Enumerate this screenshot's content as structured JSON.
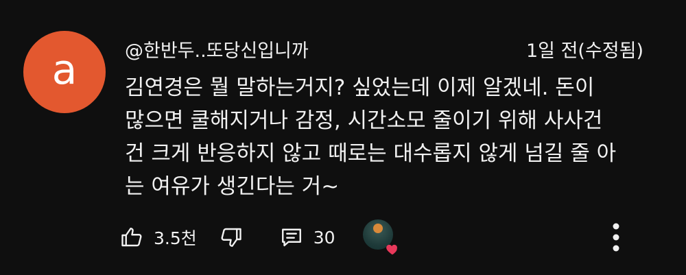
{
  "comment": {
    "avatar_letter": "a",
    "avatar_color": "#e3582f",
    "author_handle": "@한반두..또당신입니까",
    "timestamp": "1일 전(수정됨)",
    "text_lines": [
      "김연경은 뭘 말하는거지? 싶었는데 이제 알겠네. 돈이",
      "많으면 쿨해지거나 감정, 시간소모 줄이기 위해 사사건",
      "건 크게 반응하지 않고 때로는 대수롭지 않게 넘길 줄 아",
      "는 여유가 생긴다는 거~"
    ]
  },
  "actions": {
    "like_icon": "thumbs-up-icon",
    "like_count": "3.5천",
    "dislike_icon": "thumbs-down-icon",
    "reply_icon": "comment-icon",
    "reply_count": "30",
    "creator_heart_icon": "heart-icon",
    "heart_color": "#e8385a",
    "more_icon": "more-vertical-icon"
  }
}
